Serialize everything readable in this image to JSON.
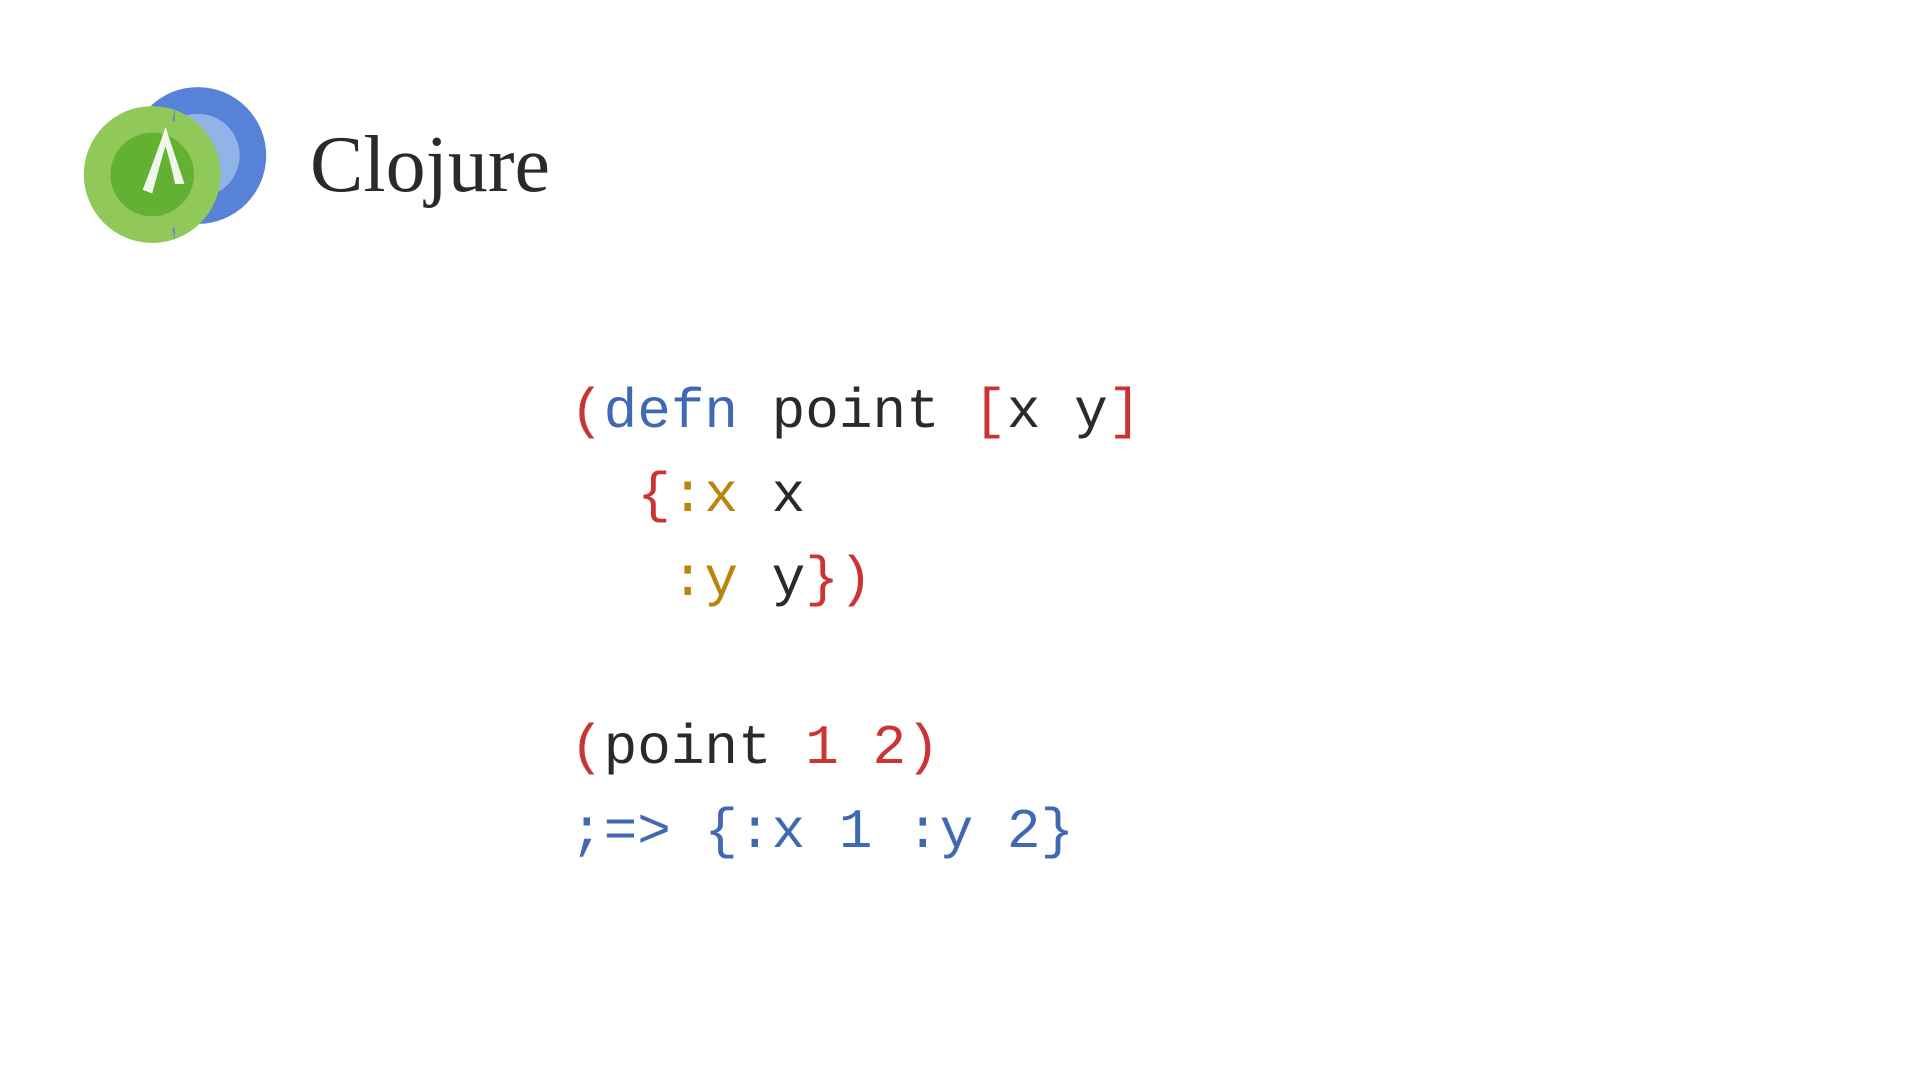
{
  "title": "Clojure",
  "code": {
    "line1": {
      "open_paren": "(",
      "defn": "defn",
      "space1": " ",
      "fn_name": "point",
      "space2": " ",
      "open_bracket": "[",
      "param_x": "x",
      "space3": " ",
      "param_y": "y",
      "close_bracket": "]"
    },
    "line2": {
      "indent": "  ",
      "open_brace": "{",
      "kw_x": ":x",
      "space1": " ",
      "val_x": "x"
    },
    "line3": {
      "indent": "   ",
      "kw_y": ":y",
      "space1": " ",
      "val_y": "y",
      "close_brace": "}",
      "close_paren": ")"
    },
    "line4": "",
    "line5": {
      "open_paren": "(",
      "fn_call": "point",
      "space1": " ",
      "arg1": "1",
      "space2": " ",
      "arg2": "2",
      "close_paren": ")"
    },
    "line6": {
      "comment": ";=> {:x 1 :y 2}"
    }
  },
  "logo_colors": {
    "blue_dark": "#5881d8",
    "blue_light": "#91b4e8",
    "green_dark": "#63b132",
    "green_light": "#90c95a"
  }
}
